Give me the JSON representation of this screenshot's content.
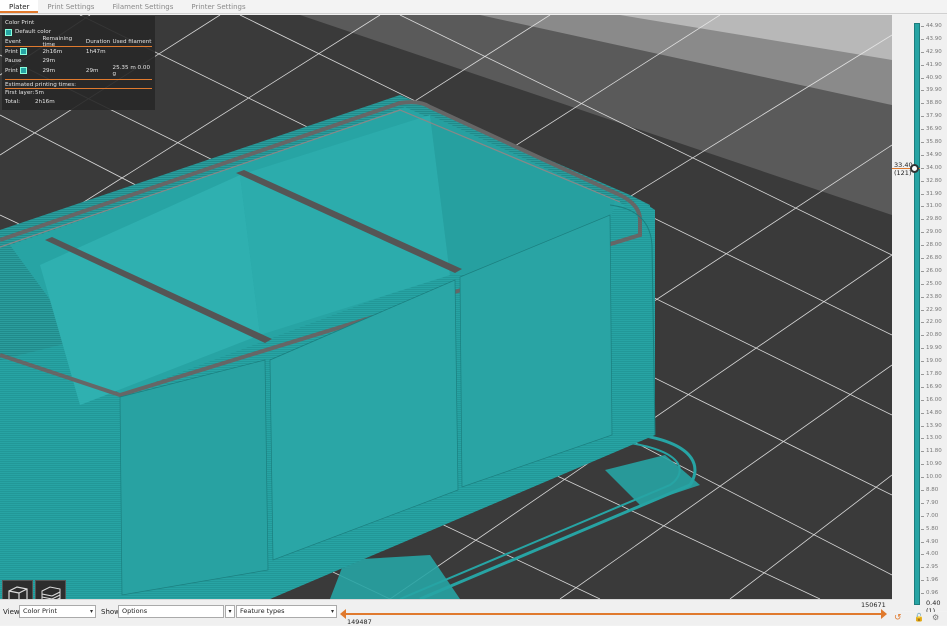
{
  "tabs": [
    {
      "label": "Plater",
      "active": true
    },
    {
      "label": "Print Settings",
      "active": false
    },
    {
      "label": "Filament Settings",
      "active": false
    },
    {
      "label": "Printer Settings",
      "active": false
    }
  ],
  "legend": {
    "title": "Color Print",
    "default_color_label": "Default color",
    "headers": [
      "Event",
      "Remaining time",
      "Duration",
      "Used filament"
    ],
    "rows": [
      {
        "event": "Print",
        "swatch": true,
        "remaining": "2h16m",
        "duration": "1h47m",
        "used": ""
      },
      {
        "event": "Pause",
        "swatch": false,
        "remaining": "29m",
        "duration": "",
        "used": ""
      },
      {
        "event": "Print",
        "swatch": true,
        "remaining": "29m",
        "duration": "29m",
        "used": "25.35 m   0.00 g"
      }
    ],
    "estimated_title": "Estimated printing times:",
    "first_layer_label": "First layer:",
    "first_layer_value": "5m",
    "total_label": "Total:",
    "total_value": "2h16m"
  },
  "colors": {
    "accent": "#e07a2e",
    "filament": "#27a4a4",
    "bed": "#3a3a3a"
  },
  "vertical_slider": {
    "top_value": "33.40",
    "top_layer": "(121)",
    "bottom_value": "0.40",
    "bottom_layer": "(1)",
    "ticks": [
      "44.90",
      "43.90",
      "42.90",
      "41.90",
      "40.90",
      "39.90",
      "38.80",
      "37.90",
      "36.90",
      "35.80",
      "34.90",
      "34.00",
      "32.80",
      "31.90",
      "31.00",
      "29.80",
      "29.00",
      "28.00",
      "26.80",
      "26.00",
      "25.00",
      "23.80",
      "22.90",
      "22.00",
      "20.80",
      "19.90",
      "19.00",
      "17.80",
      "16.90",
      "16.00",
      "14.80",
      "13.90",
      "13.00",
      "11.80",
      "10.90",
      "10.00",
      "8.80",
      "7.90",
      "7.00",
      "5.80",
      "4.90",
      "4.00",
      "2.95",
      "1.96",
      "0.96"
    ]
  },
  "bottom_bar": {
    "view_label": "View",
    "view_value": "Color Print",
    "show_label": "Show",
    "show_value": "Options",
    "feature_value": "Feature types",
    "h_max": "150671",
    "h_min": "149487"
  },
  "icons": [
    "view-iso-cube-icon",
    "view-layers-cube-icon",
    "undo-arrow-icon",
    "lock-icon",
    "settings-gear-icon"
  ]
}
